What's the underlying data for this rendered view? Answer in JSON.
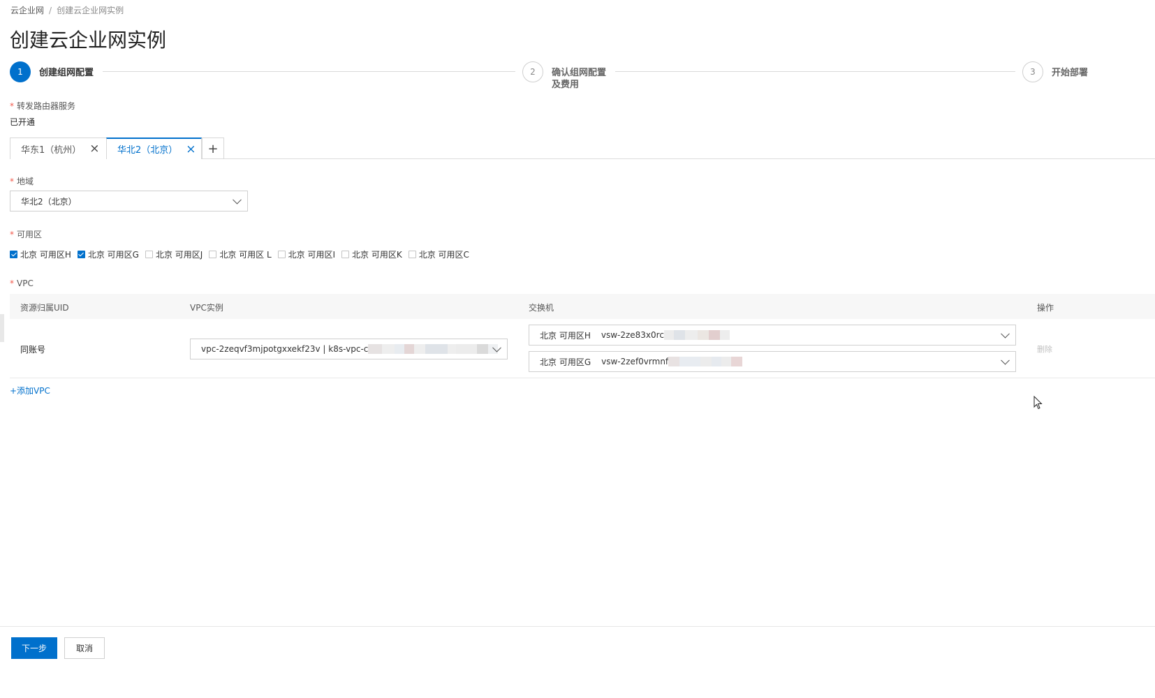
{
  "breadcrumb": {
    "root": "云企业网",
    "separator": "/",
    "current": "创建云企业网实例"
  },
  "page_title": "创建云企业网实例",
  "steps": [
    {
      "number": "1",
      "label": "创建组网配置",
      "state": "active"
    },
    {
      "number": "2",
      "label_line1": "确认组网配置",
      "label_line2": "及费用",
      "state": "pending"
    },
    {
      "number": "3",
      "label": "开始部署",
      "state": "pending"
    }
  ],
  "router_service": {
    "label": "转发路由器服务",
    "value": "已开通"
  },
  "region_tabs": [
    {
      "label": "华东1（杭州）",
      "active": false
    },
    {
      "label": "华北2（北京）",
      "active": true
    }
  ],
  "add_tab_symbol": "+",
  "region": {
    "label": "地域",
    "value": "华北2（北京）"
  },
  "zones": {
    "label": "可用区",
    "options": [
      {
        "label": "北京 可用区H",
        "checked": true
      },
      {
        "label": "北京 可用区G",
        "checked": true
      },
      {
        "label": "北京 可用区J",
        "checked": false
      },
      {
        "label": "北京 可用区 L",
        "checked": false
      },
      {
        "label": "北京 可用区I",
        "checked": false
      },
      {
        "label": "北京 可用区K",
        "checked": false
      },
      {
        "label": "北京 可用区C",
        "checked": false
      }
    ]
  },
  "vpc": {
    "label": "VPC",
    "columns": [
      "资源归属UID",
      "VPC实例",
      "交换机",
      "操作"
    ],
    "row": {
      "uid": "同账号",
      "vpc_instance": "vpc-2zeqvf3mjpotgxxekf23v | k8s-vpc-c",
      "switches": [
        {
          "zone": "北京 可用区H",
          "id": "vsw-2ze83x0rc"
        },
        {
          "zone": "北京 可用区G",
          "id": "vsw-2zef0vrmnf"
        }
      ],
      "action": "删除"
    },
    "add_link": "+添加VPC"
  },
  "footer": {
    "next_label": "下一步",
    "cancel_label": "取消"
  },
  "colors": {
    "primary": "#0070cc",
    "required": "#f2594b"
  }
}
